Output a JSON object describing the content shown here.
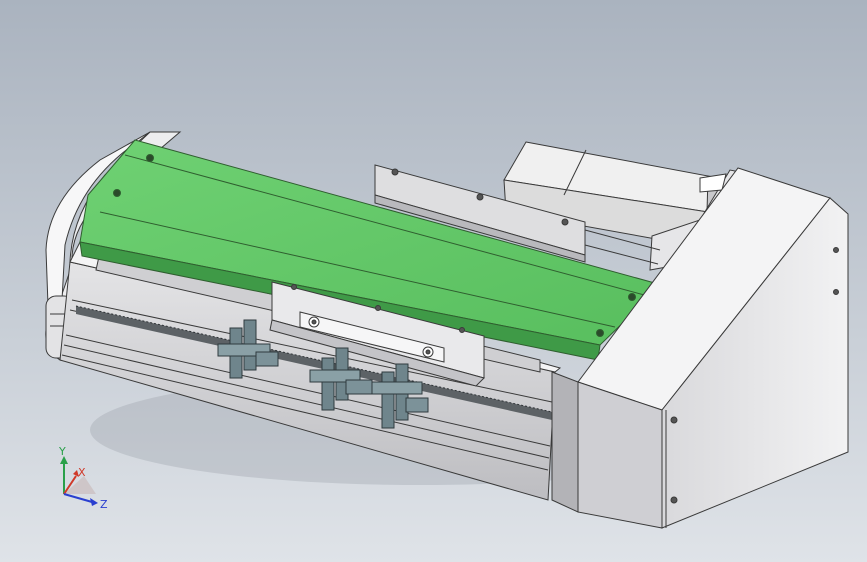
{
  "viewport": {
    "background_top": "#aab3bf",
    "background_bottom": "#dfe3e8"
  },
  "model": {
    "description_icon": "linear-module-cad-model",
    "colors": {
      "belt_top": "#66c96b",
      "belt_front": "#3f9a47",
      "body_light": "#eaeaec",
      "body_mid": "#d3d3d6",
      "body_dark": "#a7a7ac",
      "outline": "#3a3a3a",
      "sensor": "#6a7f86",
      "motor": "#ececec"
    }
  },
  "triad": {
    "x_label": "X",
    "y_label": "Y",
    "z_label": "Z",
    "x_color": "#d03a2a",
    "y_color": "#2aa04a",
    "z_color": "#2a3fd0"
  }
}
